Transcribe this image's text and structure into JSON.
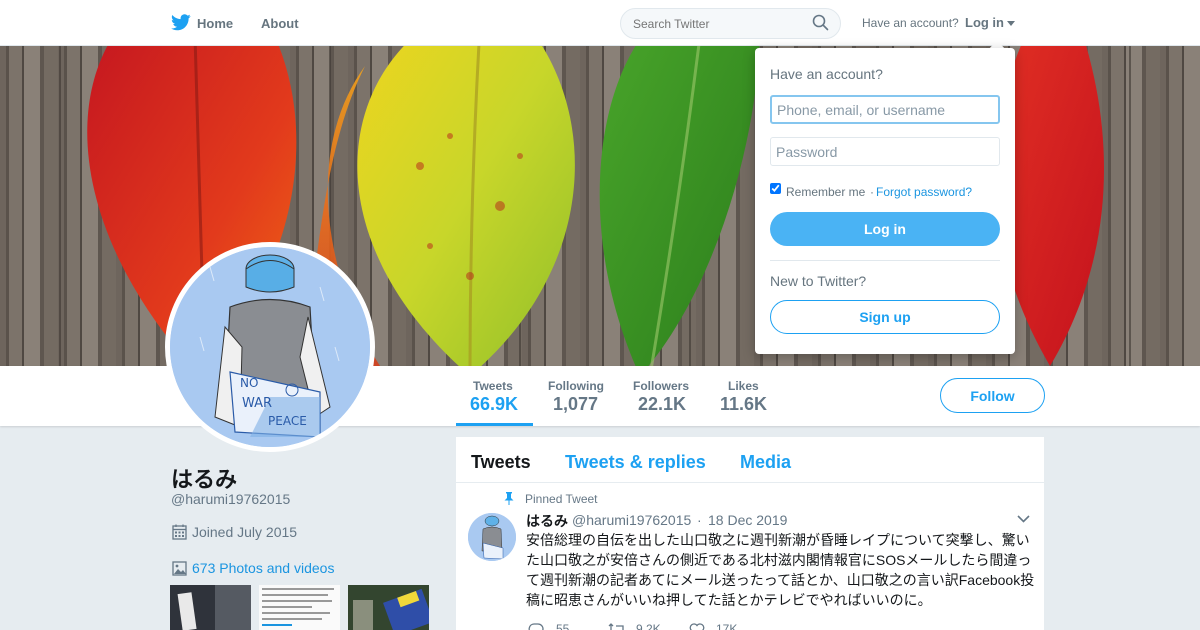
{
  "nav": {
    "home_label": "Home",
    "about_label": "About",
    "search_placeholder": "Search Twitter",
    "have_account": "Have an account?",
    "login_label": "Log in"
  },
  "profile": {
    "name": "はるみ",
    "handle": "@harumi19762015",
    "joined": "Joined July 2015",
    "photos_link": "673 Photos and videos"
  },
  "stats": [
    {
      "label": "Tweets",
      "value": "66.9K"
    },
    {
      "label": "Following",
      "value": "1,077"
    },
    {
      "label": "Followers",
      "value": "22.1K"
    },
    {
      "label": "Likes",
      "value": "11.6K"
    }
  ],
  "follow_label": "Follow",
  "timeline": {
    "tabs": [
      "Tweets",
      "Tweets & replies",
      "Media"
    ],
    "pinned_label": "Pinned Tweet",
    "tweet": {
      "name": "はるみ",
      "handle": "@harumi19762015",
      "separator": "·",
      "date": "18 Dec 2019",
      "text": "安倍総理の自伝を出した山口敬之に週刊新潮が昏睡レイプについて突撃し、驚いた山口敬之が安倍さんの側近である北村滋内閣情報官にSOSメールしたら間違って週刊新潮の記者あてにメール送ったって話とか、山口敬之の言い訳Facebook投稿に昭恵さんがいいね押してた話とかテレビでやればいいのに。",
      "replies": "55",
      "retweets": "9.2K",
      "likes": "17K"
    }
  },
  "login_dropdown": {
    "title": "Have an account?",
    "username_placeholder": "Phone, email, or username",
    "password_placeholder": "Password",
    "remember_label": "Remember me",
    "separator": "·",
    "forgot_label": "Forgot password?",
    "login_button": "Log in",
    "new_to_twitter": "New to Twitter?",
    "signup_button": "Sign up"
  },
  "colors": {
    "brand": "#1da1f2",
    "login_button": "#4ab3f4",
    "page_background": "#e6ecf0"
  },
  "icons": {
    "logo": "twitter-bird-icon",
    "search": "search-icon",
    "calendar": "calendar-icon",
    "photos": "photo-icon",
    "pin": "pin-icon",
    "reply": "reply-icon",
    "retweet": "retweet-icon",
    "like": "heart-icon"
  }
}
